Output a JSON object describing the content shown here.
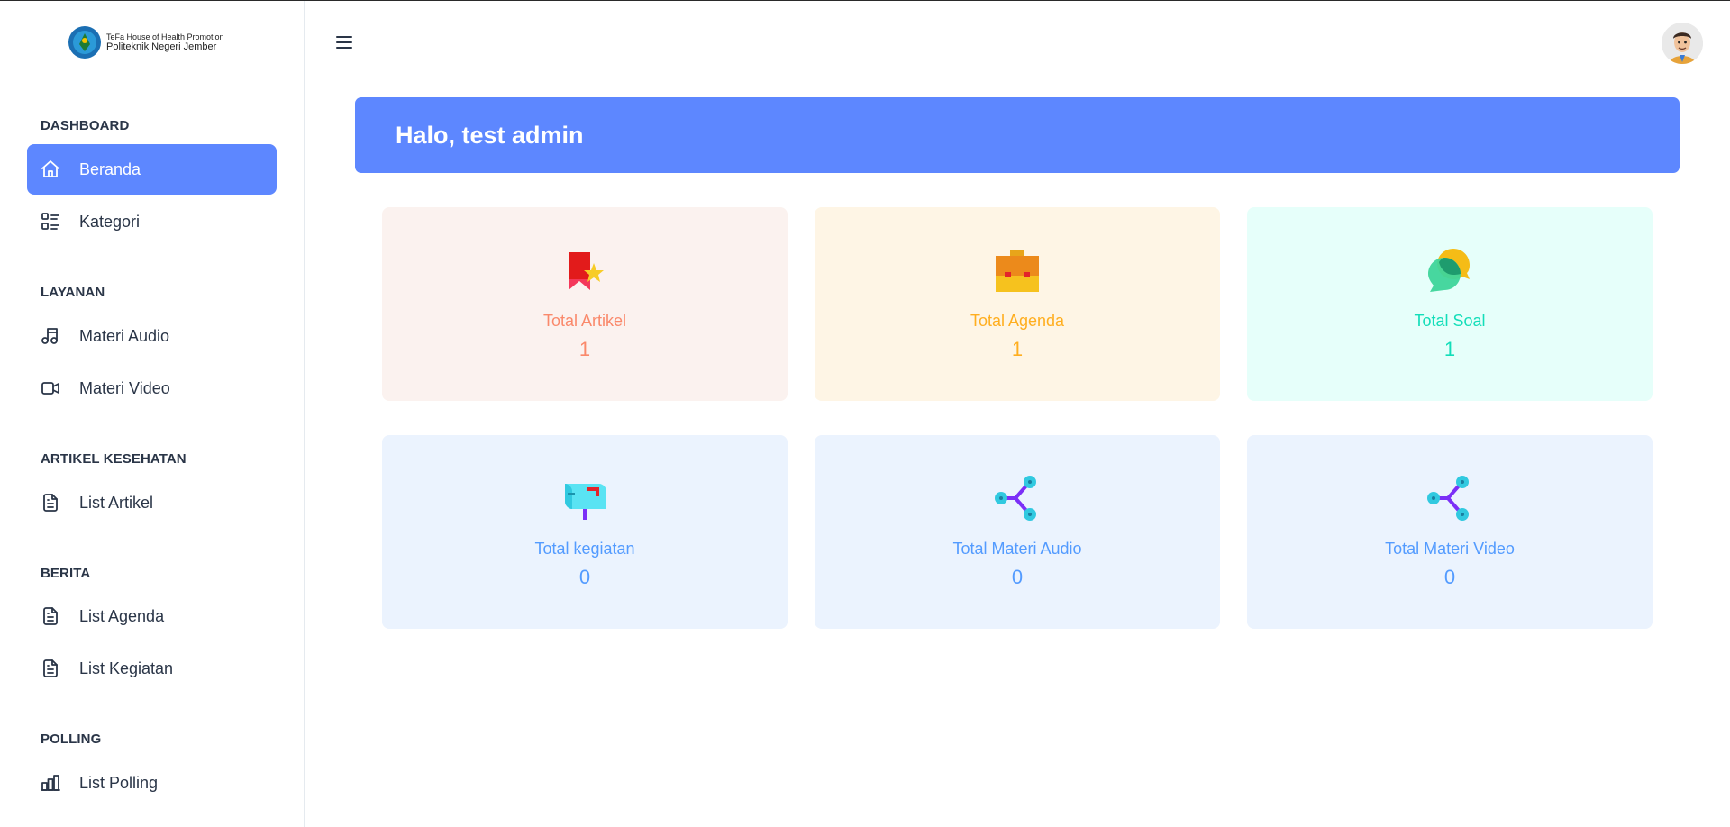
{
  "brand": {
    "line1": "TeFa House of Health Promotion",
    "line2": "Politeknik Negeri Jember"
  },
  "sidebar": {
    "sections": [
      {
        "title": "DASHBOARD"
      },
      {
        "title": "LAYANAN"
      },
      {
        "title": "ARTIKEL KESEHATAN"
      },
      {
        "title": "BERITA"
      },
      {
        "title": "POLLING"
      }
    ],
    "items": [
      {
        "label": "Beranda",
        "icon": "home-icon",
        "active": true
      },
      {
        "label": "Kategori",
        "icon": "category-list-icon"
      },
      {
        "label": "Materi Audio",
        "icon": "music-icon"
      },
      {
        "label": "Materi Video",
        "icon": "video-icon"
      },
      {
        "label": "List Artikel",
        "icon": "file-text-icon"
      },
      {
        "label": "List Agenda",
        "icon": "file-text-icon"
      },
      {
        "label": "List Kegiatan",
        "icon": "file-text-icon"
      },
      {
        "label": "List Polling",
        "icon": "chart-bar-icon"
      }
    ]
  },
  "banner": {
    "greeting": "Halo, test admin"
  },
  "cards": [
    {
      "label": "Total Artikel",
      "value": "1",
      "icon": "ribbon-star-icon",
      "color": "#fa896b"
    },
    {
      "label": "Total Agenda",
      "value": "1",
      "icon": "briefcase-icon",
      "color": "#ffae1f"
    },
    {
      "label": "Total Soal",
      "value": "1",
      "icon": "chat-bubbles-icon",
      "color": "#13deb9"
    },
    {
      "label": "Total kegiatan",
      "value": "0",
      "icon": "mailbox-icon",
      "color": "#539bff"
    },
    {
      "label": "Total Materi Audio",
      "value": "0",
      "icon": "share-nodes-icon",
      "color": "#539bff"
    },
    {
      "label": "Total Materi Video",
      "value": "0",
      "icon": "share-nodes-icon",
      "color": "#539bff"
    }
  ],
  "colors": {
    "primary": "#5d87ff",
    "text": "#2a3547"
  }
}
